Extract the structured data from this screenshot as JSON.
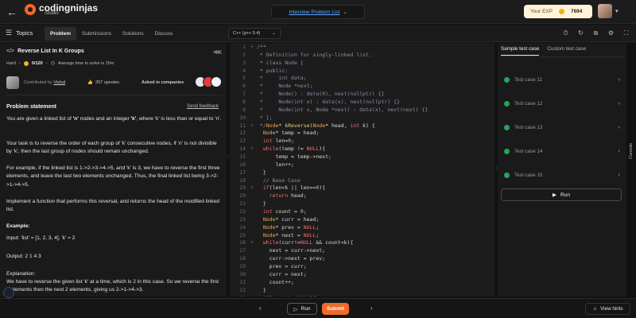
{
  "topbar": {
    "logo_text": "codingninjas",
    "logo_sub": "/studio",
    "problem_list_label": "Interview Problem List",
    "exp_label": "Your EXP",
    "exp_value": "7694"
  },
  "subbar": {
    "topics_label": "Topics",
    "tabs": [
      {
        "label": "Problem"
      },
      {
        "label": "Submissions"
      },
      {
        "label": "Solutions"
      },
      {
        "label": "Discuss"
      }
    ],
    "language": "C++ (g++ 5.4)"
  },
  "problem": {
    "title": "Reverse List In K Groups",
    "difficulty": "Hard",
    "score": "0/120",
    "avg_time": "Average time to solve is 15m",
    "contributed_by": "Contributed by",
    "contributor": "Vishal",
    "upvotes": "257 upvotes",
    "asked_in": "Asked in companies",
    "statement_heading": "Problem statement",
    "send_feedback": "Send feedback",
    "p1_a": "You are given a linked list of ",
    "p1_n": "'n'",
    "p1_b": " nodes and an integer ",
    "p1_k": "'k'",
    "p1_c": ", where 'k' is less than or equal to 'n'.",
    "p2": "Your task is to reverse the order of each group of 'k' consecutive nodes, if 'n' is not divisible by 'k', then the last group of nodes should remain unchanged.",
    "p3": "For example, if the linked list is 1->2->3->4->5, and 'k' is 3, we have to reverse the first three elements, and leave the last two elements unchanged. Thus, the final linked list being 3->2->1->4->5.",
    "p4": "Implement a function that performs this reversal, and returns the head of the modified linked list.",
    "example_heading": "Example:",
    "input": "Input: 'list' = [1, 2, 3, 4], 'k' = 2",
    "output": "Output: 2 1 4 3",
    "explanation_heading": "Explanation:",
    "explanation": "We have to reverse the given list 'k' at a time, which is 2 in this case. So we reverse the first 2 elements then the next 2 elements, giving us 2->1->4->3."
  },
  "code_lines": [
    {
      "n": "1",
      "html": "<span class=\"c-cm\">/**</span>"
    },
    {
      "n": "2",
      "html": "<span class=\"c-cm\"> * Definition for singly-linked list.</span>"
    },
    {
      "n": "3",
      "html": "<span class=\"c-cm\"> * class Node {</span>"
    },
    {
      "n": "4",
      "html": "<span class=\"c-cm\"> * public:</span>"
    },
    {
      "n": "5",
      "html": "<span class=\"c-cm\"> *     int data;</span>"
    },
    {
      "n": "6",
      "html": "<span class=\"c-cm\"> *     Node *next;</span>"
    },
    {
      "n": "7",
      "html": "<span class=\"c-cm\"> *     Node() : data(0), next(nullptr) {}</span>"
    },
    {
      "n": "8",
      "html": "<span class=\"c-cm\"> *     Node(int x) : data(x), next(nullptr) {}</span>"
    },
    {
      "n": "9",
      "html": "<span class=\"c-cm\"> *     Node(int x, Node *next) : data(x), next(next) {}</span>"
    },
    {
      "n": "10",
      "html": "<span class=\"c-cm\"> * };</span>"
    },
    {
      "n": "11",
      "html": "<span class=\"c-cm\"> */</span><span class=\"c-ty\">Node</span><span class=\"c-pl\">* </span><span class=\"c-fn\">kReverse</span><span class=\"c-pl\">(</span><span class=\"c-ty\">Node</span><span class=\"c-pl\">* head, </span><span class=\"c-kw\">int</span><span class=\"c-pl\"> k) {</span>"
    },
    {
      "n": "12",
      "html": "<span class=\"c-pl\">  </span><span class=\"c-ty\">Node</span><span class=\"c-pl\">* temp = head;</span>"
    },
    {
      "n": "13",
      "html": "<span class=\"c-pl\">  </span><span class=\"c-kw\">int</span><span class=\"c-pl\"> len=</span><span class=\"c-nu\">0</span><span class=\"c-pl\">;</span>"
    },
    {
      "n": "14",
      "html": "<span class=\"c-pl\">  </span><span class=\"c-kw\">while</span><span class=\"c-pl\">(temp != </span><span class=\"c-kw\">NULL</span><span class=\"c-pl\">){</span>"
    },
    {
      "n": "15",
      "html": "<span class=\"c-pl\">      temp = temp-&gt;next;</span>"
    },
    {
      "n": "16",
      "html": "<span class=\"c-pl\">      len++;</span>"
    },
    {
      "n": "17",
      "html": "<span class=\"c-pl\">  }</span>"
    },
    {
      "n": "18",
      "html": "<span class=\"c-cm\">  // Base Case</span>"
    },
    {
      "n": "19",
      "html": "<span class=\"c-pl\">  </span><span class=\"c-kw\">if</span><span class=\"c-pl\">(len&lt;k || len==</span><span class=\"c-nu\">0</span><span class=\"c-pl\">){</span>"
    },
    {
      "n": "20",
      "html": "<span class=\"c-pl\">    </span><span class=\"c-kw\">return</span><span class=\"c-pl\"> head;</span>"
    },
    {
      "n": "21",
      "html": "<span class=\"c-pl\">  }</span>"
    },
    {
      "n": "22",
      "html": "<span class=\"c-pl\">  </span><span class=\"c-kw\">int</span><span class=\"c-pl\"> count = </span><span class=\"c-nu\">0</span><span class=\"c-pl\">;</span>"
    },
    {
      "n": "23",
      "html": "<span class=\"c-pl\">  </span><span class=\"c-ty\">Node</span><span class=\"c-pl\">* curr = head;</span>"
    },
    {
      "n": "24",
      "html": "<span class=\"c-pl\">  </span><span class=\"c-ty\">Node</span><span class=\"c-pl\">* prev = </span><span class=\"c-kw\">NULL</span><span class=\"c-pl\">;</span>"
    },
    {
      "n": "25",
      "html": "<span class=\"c-pl\">  </span><span class=\"c-ty\">Node</span><span class=\"c-pl\">* next = </span><span class=\"c-kw\">NULL</span><span class=\"c-pl\">;</span>"
    },
    {
      "n": "26",
      "html": "<span class=\"c-pl\">  </span><span class=\"c-kw\">while</span><span class=\"c-pl\">(curr!=</span><span class=\"c-kw\">NULL</span><span class=\"c-pl\"> &amp;&amp; count&lt;k){</span>"
    },
    {
      "n": "27",
      "html": "<span class=\"c-pl\">    next = curr-&gt;next;</span>"
    },
    {
      "n": "28",
      "html": "<span class=\"c-pl\">    curr-&gt;next = prev;</span>"
    },
    {
      "n": "29",
      "html": "<span class=\"c-pl\">    prev = curr;</span>"
    },
    {
      "n": "30",
      "html": "<span class=\"c-pl\">    curr = next;</span>"
    },
    {
      "n": "31",
      "html": "<span class=\"c-pl\">    count++;</span>"
    },
    {
      "n": "32",
      "html": "<span class=\"c-pl\">  }</span>"
    },
    {
      "n": "33",
      "html": "<span class=\"c-pl\">  </span><span class=\"c-kw\">if</span><span class=\"c-pl\">(next != </span><span class=\"c-kw\">NULL</span><span class=\"c-pl\">){</span>"
    }
  ],
  "tests": {
    "tab_sample": "Sample test case",
    "tab_custom": "Custom test case",
    "cases": [
      "Test case 11",
      "Test case 12",
      "Test case 13",
      "Test case 14",
      "Test case 15"
    ],
    "run_label": "Run",
    "console_label": "Console"
  },
  "bottombar": {
    "run_label": "Run",
    "submit_label": "Submit",
    "hints_label": "View hints"
  },
  "colors": {
    "accent": "#f06a2a",
    "success": "#23a55a",
    "link": "#5aa8ff"
  }
}
